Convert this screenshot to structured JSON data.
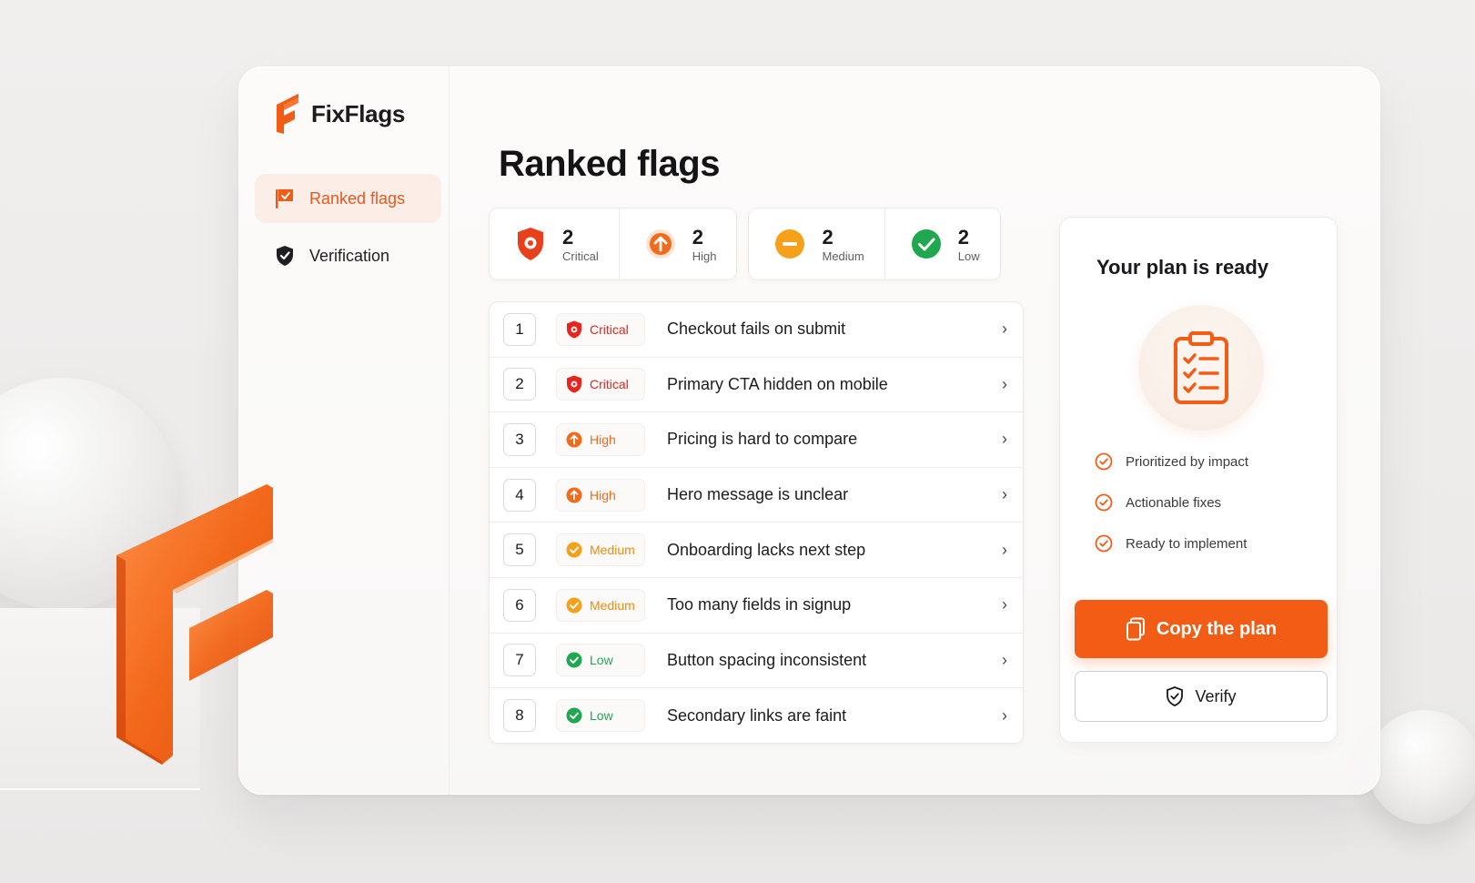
{
  "app": {
    "name": "FixFlags"
  },
  "sidebar": {
    "items": [
      {
        "label": "Ranked flags",
        "active": true,
        "icon": "flag-icon"
      },
      {
        "label": "Verification",
        "active": false,
        "icon": "shield-check-icon"
      }
    ]
  },
  "main": {
    "title": "Ranked flags",
    "stats": [
      {
        "count": "2",
        "label": "Critical",
        "icon": "shield-alert-icon",
        "color": "#e8401c"
      },
      {
        "count": "2",
        "label": "High",
        "icon": "arrow-up-circle-icon",
        "color": "#f26a1b"
      },
      {
        "count": "2",
        "label": "Medium",
        "icon": "minus-circle-icon",
        "color": "#f5a11b"
      },
      {
        "count": "2",
        "label": "Low",
        "icon": "check-circle-icon",
        "color": "#1fa84f"
      }
    ],
    "flags": [
      {
        "rank": "1",
        "severity": "Critical",
        "title": "Checkout fails on submit"
      },
      {
        "rank": "2",
        "severity": "Critical",
        "title": "Primary CTA hidden on mobile"
      },
      {
        "rank": "3",
        "severity": "High",
        "title": "Pricing is hard to compare"
      },
      {
        "rank": "4",
        "severity": "High",
        "title": "Hero message is unclear"
      },
      {
        "rank": "5",
        "severity": "Medium",
        "title": "Onboarding lacks next step"
      },
      {
        "rank": "6",
        "severity": "Medium",
        "title": "Too many fields in signup"
      },
      {
        "rank": "7",
        "severity": "Low",
        "title": "Button spacing inconsistent"
      },
      {
        "rank": "8",
        "severity": "Low",
        "title": "Secondary links are faint"
      }
    ]
  },
  "plan": {
    "title": "Your plan is ready",
    "benefits": [
      "Prioritized by impact",
      "Actionable fixes",
      "Ready to implement"
    ],
    "copy_label": "Copy the plan",
    "verify_label": "Verify"
  },
  "colors": {
    "accent": "#f25c14",
    "critical": "#e8241c",
    "high": "#f26a1b",
    "medium": "#f5a11b",
    "low": "#1fa84f"
  }
}
